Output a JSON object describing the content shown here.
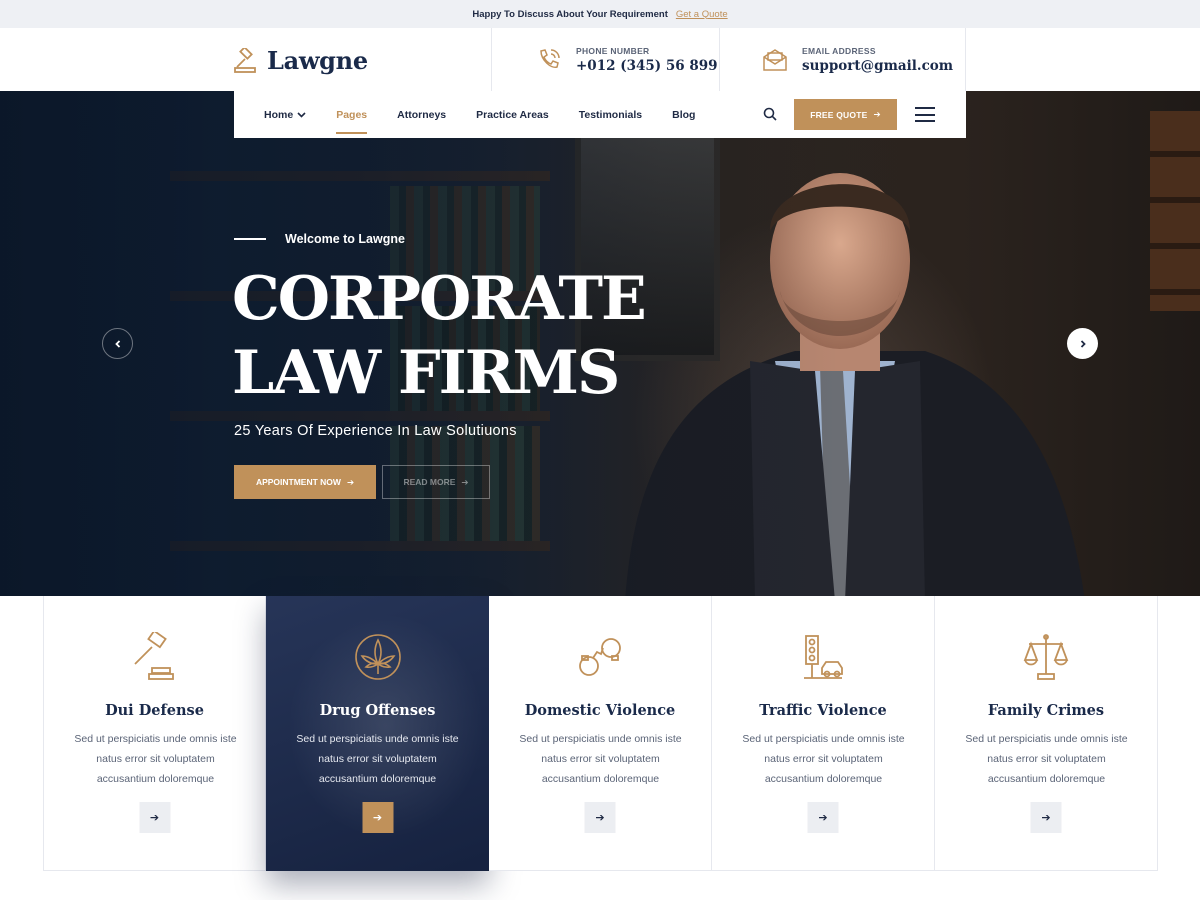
{
  "topbar": {
    "text": "Happy To Discuss About Your Requirement",
    "link": "Get a Quote"
  },
  "brand": {
    "name": "Lawgne",
    "icon": "gavel-icon"
  },
  "contact": {
    "phone_label": "PHONE NUMBER",
    "phone_value": "+012 (345) 56 899",
    "email_label": "EMAIL ADDRESS",
    "email_value": "support@gmail.com"
  },
  "nav": {
    "items": [
      {
        "label": "Home",
        "dropdown": true
      },
      {
        "label": "Pages",
        "active": true
      },
      {
        "label": "Attorneys"
      },
      {
        "label": "Practice Areas"
      },
      {
        "label": "Testimonials"
      },
      {
        "label": "Blog"
      }
    ],
    "free_quote": "FREE QUOTE"
  },
  "hero": {
    "welcome": "Welcome to Lawgne",
    "title_line1": "CORPORATE",
    "title_line2": "LAW FIRMS",
    "subtitle": "25 Years Of Experience In Law Solutiuons",
    "primary_button": "APPOINTMENT NOW",
    "secondary_button": "READ MORE"
  },
  "services": [
    {
      "title": "Dui Defense",
      "text": "Sed ut perspiciatis unde omnis iste natus error sit voluptatem accusantium doloremque",
      "icon": "gavel-icon"
    },
    {
      "title": "Drug Offenses",
      "text": "Sed ut perspiciatis unde omnis iste natus error sit voluptatem accusantium doloremque",
      "icon": "cannabis-leaf-icon"
    },
    {
      "title": "Domestic Violence",
      "text": "Sed ut perspiciatis unde omnis iste natus error sit voluptatem accusantium doloremque",
      "icon": "handcuffs-icon"
    },
    {
      "title": "Traffic Violence",
      "text": "Sed ut perspiciatis unde omnis iste natus error sit voluptatem accusantium doloremque",
      "icon": "traffic-light-car-icon"
    },
    {
      "title": "Family Crimes",
      "text": "Sed ut perspiciatis unde omnis iste natus error sit voluptatem accusantium doloremque",
      "icon": "scales-icon"
    }
  ],
  "colors": {
    "accent": "#c0915a",
    "navy": "#1b2a4f",
    "text": "#1f2a44"
  }
}
